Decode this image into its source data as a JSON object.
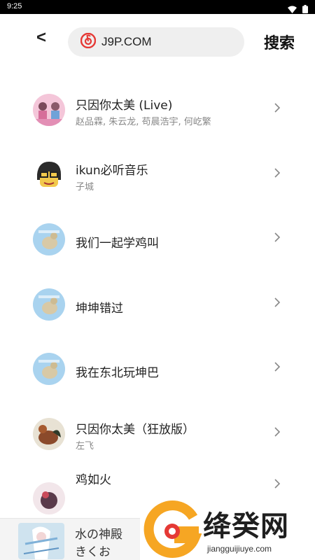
{
  "status_bar": {
    "time": "9:25",
    "icons": [
      "wifi-icon",
      "battery-icon"
    ]
  },
  "search": {
    "back_label": "<",
    "query": "J9P.COM",
    "search_label": "搜索",
    "accent": "#e53935"
  },
  "results": [
    {
      "title": "只因你太美 (Live)",
      "subtitle": "赵品霖, 朱云龙, 苟晨浩宇, 何屹繁"
    },
    {
      "title": "ikun必听音乐",
      "subtitle": "子城"
    },
    {
      "title": "我们一起学鸡叫",
      "subtitle": ""
    },
    {
      "title": "坤坤错过",
      "subtitle": ""
    },
    {
      "title": "我在东北玩坤巴",
      "subtitle": ""
    },
    {
      "title": "只因你太美（狂放版）",
      "subtitle": "左飞"
    },
    {
      "title": "鸡如火",
      "subtitle": ""
    }
  ],
  "player": {
    "title": "水の神殿",
    "artist": "きくお"
  },
  "watermark": {
    "text": "绛癸网",
    "url": "jiangguijiuye.com",
    "colors": [
      "#f6a623",
      "#e53935"
    ]
  }
}
